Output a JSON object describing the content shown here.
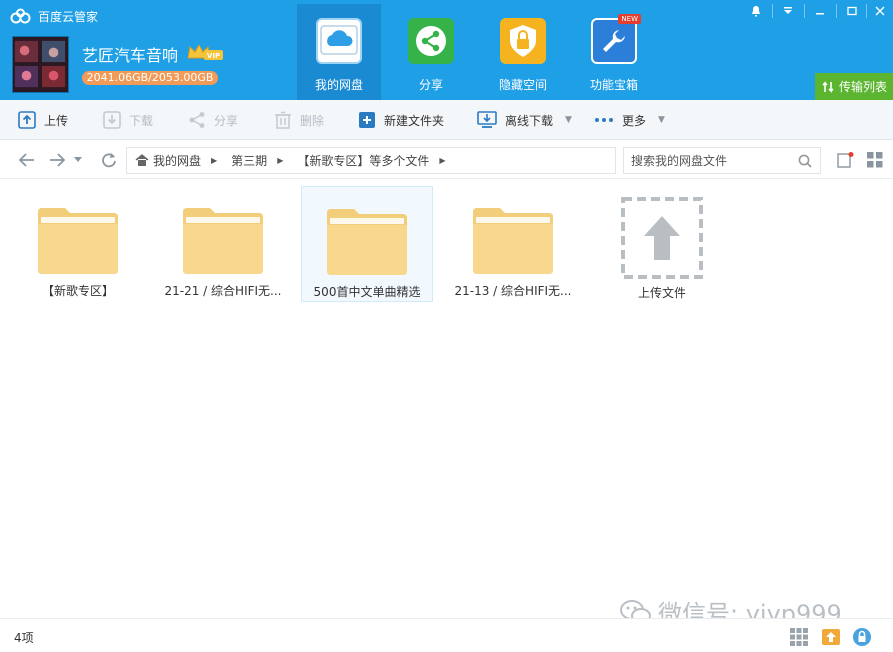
{
  "app": {
    "title": "百度云管家"
  },
  "user": {
    "name": "艺匠汽车音响",
    "vip_label": "VIP",
    "quota": "2041.06GB/2053.00GB"
  },
  "nav_tabs": [
    {
      "label": "我的网盘",
      "icon": "cloud-drive-icon",
      "active": true
    },
    {
      "label": "分享",
      "icon": "share-icon",
      "active": false
    },
    {
      "label": "隐藏空间",
      "icon": "lock-icon",
      "active": false
    },
    {
      "label": "功能宝箱",
      "icon": "toolbox-icon",
      "active": false,
      "badge": "NEW"
    }
  ],
  "transfer_list": "传输列表",
  "toolbar": {
    "upload": "上传",
    "download": "下载",
    "share": "分享",
    "delete": "删除",
    "new_folder": "新建文件夹",
    "offline_download": "离线下载",
    "more": "更多"
  },
  "breadcrumb": [
    "我的网盘",
    "第三期",
    "【新歌专区】等多个文件"
  ],
  "search": {
    "placeholder": "搜索我的网盘文件"
  },
  "files": [
    {
      "name": "【新歌专区】",
      "type": "folder"
    },
    {
      "name": "21-21 / 综合HIFI无...",
      "type": "folder"
    },
    {
      "name": "500首中文单曲精选",
      "type": "folder",
      "selected": true
    },
    {
      "name": "21-13 / 综合HIFI无...",
      "type": "folder"
    }
  ],
  "upload_tile": "上传文件",
  "status": {
    "count": "4项"
  },
  "watermark": "微信号: yjyp999",
  "colors": {
    "header": "#1e9fe6",
    "active_tab": "#1a8ad2",
    "transfer": "#5cb531",
    "folder": "#f7d88d"
  }
}
